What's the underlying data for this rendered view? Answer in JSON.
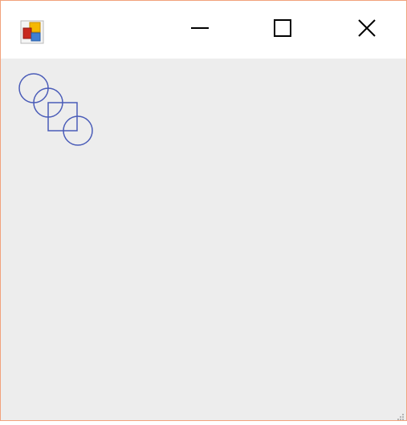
{
  "window": {
    "title": "",
    "border_color": "#f2a27c",
    "client_background": "#ededed",
    "titlebar_background": "#ffffff",
    "app_icon": "windows-forms-app-icon",
    "controls": {
      "minimize_icon": "minimize-icon",
      "maximize_icon": "maximize-icon",
      "close_icon": "close-icon"
    }
  },
  "canvas": {
    "stroke_color": "#4a5cb8",
    "shapes": [
      "circle",
      "circle",
      "square",
      "circle"
    ]
  }
}
